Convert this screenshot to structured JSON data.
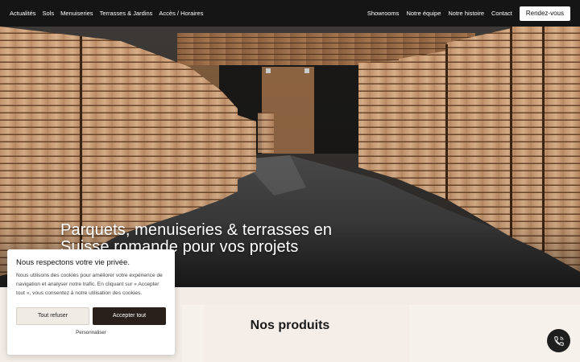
{
  "nav": {
    "left": [
      "Actualités",
      "Sols",
      "Menuiseries",
      "Terrasses & Jardins",
      "Accès / Horaires"
    ],
    "right": [
      "Showrooms",
      "Notre équipe",
      "Notre histoire",
      "Contact"
    ],
    "cta": "Rendez-vous"
  },
  "hero": {
    "title": "Parquets, menuiseries & terrasses en Suisse romande pour vos projets"
  },
  "products": {
    "title": "Nos produits"
  },
  "cookie": {
    "title": "Nous respectons votre vie privée.",
    "text": "Nous utilisons des cookies pour améliorer votre expérience de navigation et analyser notre trafic. En cliquant sur « Accepter tout », vous consentez à notre utilisation des cookies.",
    "refuse": "Tout refuser",
    "accept": "Accepter tout",
    "customize": "Personnaliser"
  },
  "icons": {
    "fab": "phone-icon"
  },
  "colors": {
    "nav_bg": "#151515",
    "accept_bg": "#2a201b",
    "section_bg": "#f3ece6"
  }
}
